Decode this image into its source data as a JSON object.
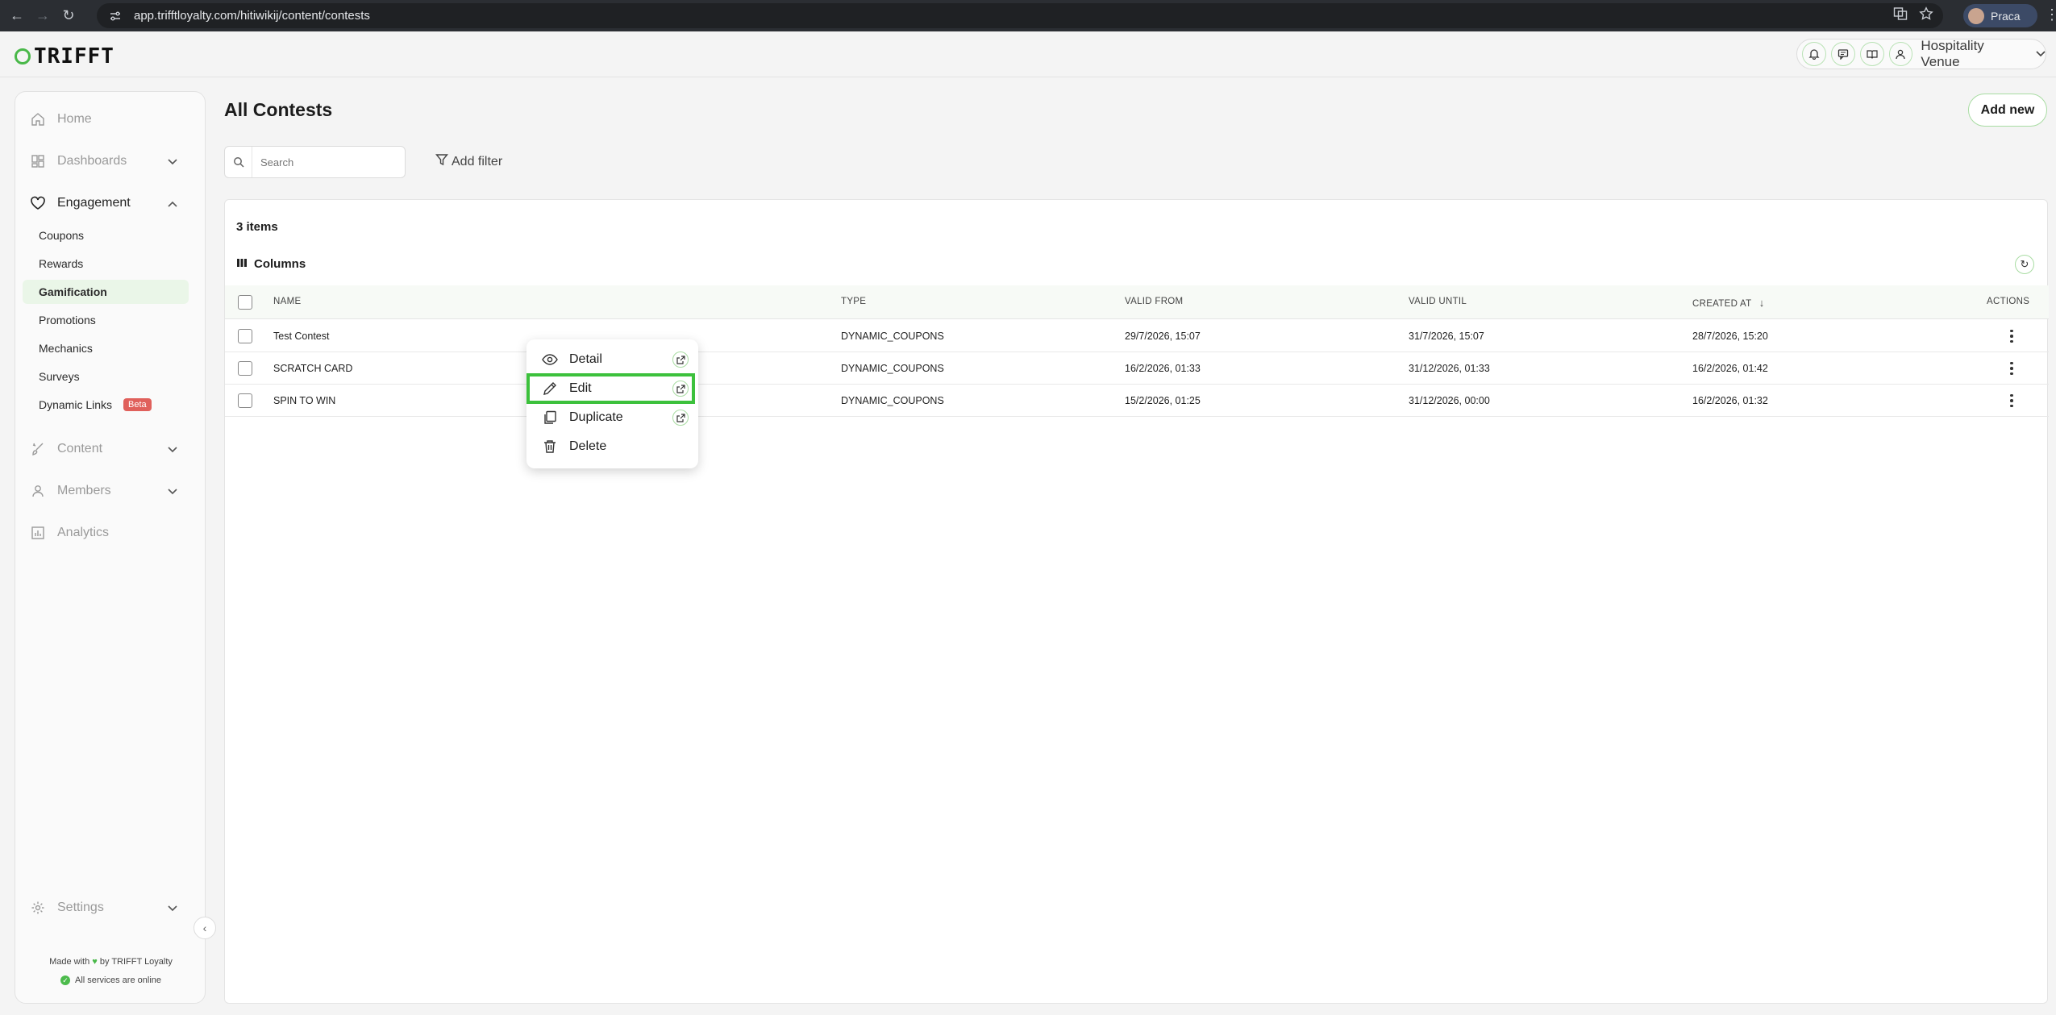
{
  "browser": {
    "url": "app.trifftloyalty.com/hitiwikij/content/contests",
    "profile_name": "Praca"
  },
  "header": {
    "logo_text": "TRIFFT",
    "venue": "Hospitality Venue"
  },
  "sidebar": {
    "items": [
      {
        "label": "Home",
        "icon": "home-icon"
      },
      {
        "label": "Dashboards",
        "icon": "dashboard-icon"
      },
      {
        "label": "Engagement",
        "icon": "heart-icon"
      },
      {
        "label": "Content",
        "icon": "brush-icon"
      },
      {
        "label": "Members",
        "icon": "user-icon"
      },
      {
        "label": "Analytics",
        "icon": "chart-icon"
      },
      {
        "label": "Settings",
        "icon": "gear-icon"
      }
    ],
    "engagement_sub": [
      "Coupons",
      "Rewards",
      "Gamification",
      "Promotions",
      "Mechanics",
      "Surveys",
      "Dynamic Links"
    ],
    "beta_label": "Beta",
    "made_with_prefix": "Made with",
    "made_with_suffix": "by TRIFFT Loyalty",
    "status": "All services are online"
  },
  "main": {
    "title": "All Contests",
    "add_new": "Add new",
    "search_placeholder": "Search",
    "add_filter": "Add filter",
    "items_count": "3 items",
    "columns_label": "Columns"
  },
  "table": {
    "headers": [
      "NAME",
      "TYPE",
      "VALID FROM",
      "VALID UNTIL",
      "CREATED AT",
      "ACTIONS"
    ],
    "rows": [
      {
        "name": "Test Contest",
        "type": "DYNAMIC_COUPONS",
        "valid_from": "29/7/2026, 15:07",
        "valid_until": "31/7/2026, 15:07",
        "created_at": "28/7/2026, 15:20"
      },
      {
        "name": "SCRATCH CARD",
        "type": "DYNAMIC_COUPONS",
        "valid_from": "16/2/2026, 01:33",
        "valid_until": "31/12/2026, 01:33",
        "created_at": "16/2/2026, 01:42"
      },
      {
        "name": "SPIN TO WIN",
        "type": "DYNAMIC_COUPONS",
        "valid_from": "15/2/2026, 01:25",
        "valid_until": "31/12/2026, 00:00",
        "created_at": "16/2/2026, 01:32"
      }
    ]
  },
  "context_menu": {
    "items": [
      {
        "label": "Detail",
        "icon": "eye-icon"
      },
      {
        "label": "Edit",
        "icon": "pencil-icon"
      },
      {
        "label": "Duplicate",
        "icon": "copy-icon"
      },
      {
        "label": "Delete",
        "icon": "trash-icon"
      }
    ]
  },
  "colors": {
    "accent": "#49b849",
    "highlight": "#3cc13c",
    "beta": "#e0605b"
  }
}
